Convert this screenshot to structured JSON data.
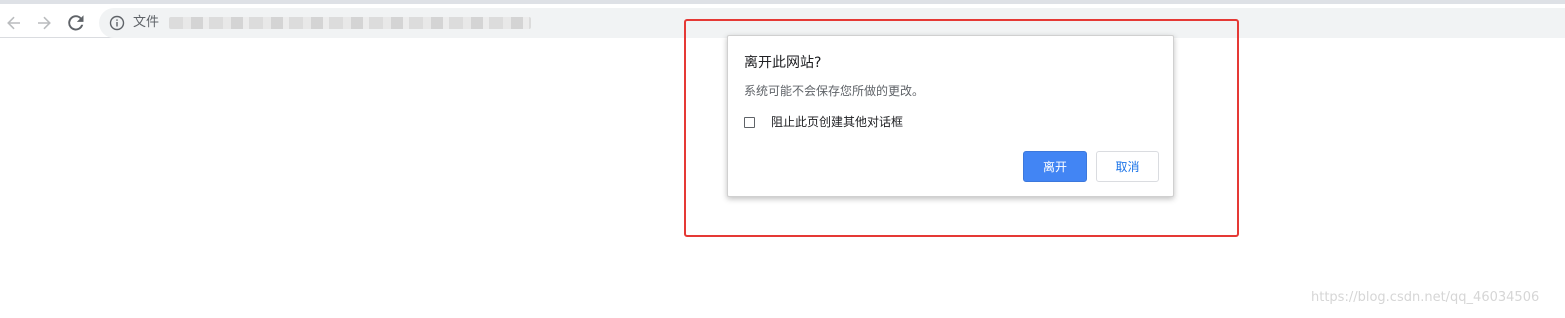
{
  "browser": {
    "back_icon": "arrow-left-icon",
    "forward_icon": "arrow-right-icon",
    "reload_icon": "reload-icon",
    "omnibox": {
      "info_icon": "info-icon",
      "scheme_label": "文件"
    }
  },
  "dialog": {
    "title": "离开此网站?",
    "message": "系统可能不会保存您所做的更改。",
    "checkbox_label": "阻止此页创建其他对话框",
    "checkbox_checked": false,
    "leave_label": "离开",
    "cancel_label": "取消",
    "highlight_color": "#e53935",
    "primary_color": "#4285f4"
  },
  "watermark": {
    "text": "https://blog.csdn.net/qq_46034506"
  }
}
